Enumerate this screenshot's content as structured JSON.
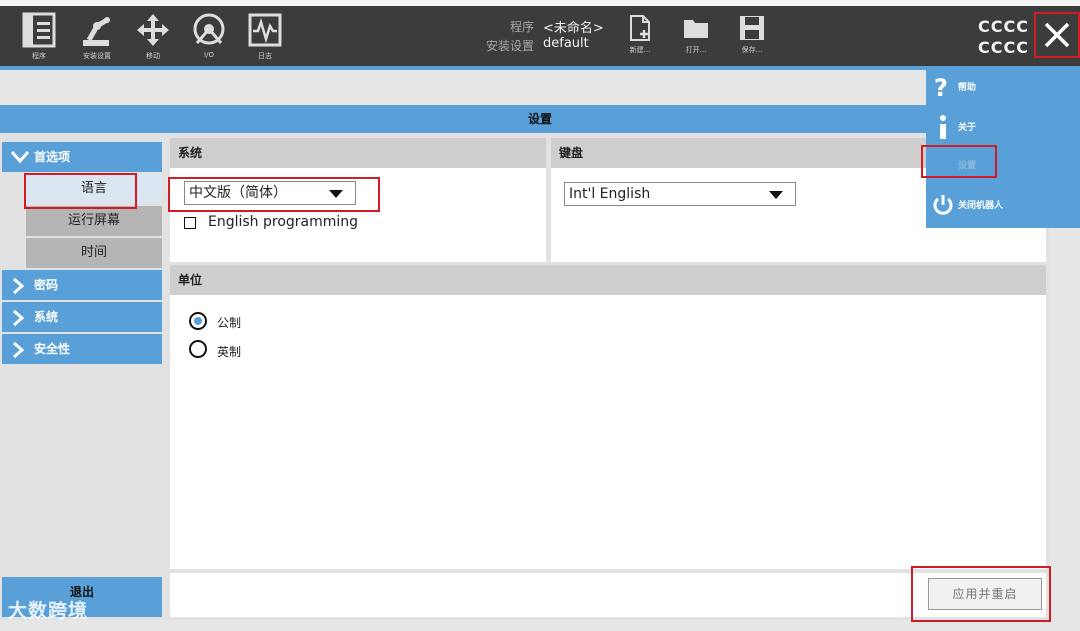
{
  "toolbar": {
    "nav": [
      {
        "label": "程序",
        "icon": "program-icon"
      },
      {
        "label": "安装设置",
        "icon": "robot-arm-icon"
      },
      {
        "label": "移动",
        "icon": "move-arrows-icon"
      },
      {
        "label": "I/O",
        "icon": "io-icon"
      },
      {
        "label": "日志",
        "icon": "log-icon"
      }
    ],
    "program_label": "程序",
    "program_value": "<未命名>",
    "install_label": "安装设置",
    "install_value": "default",
    "files": [
      {
        "label": "新建...",
        "icon": "new-file-icon"
      },
      {
        "label": "打开...",
        "icon": "folder-icon"
      },
      {
        "label": "保存...",
        "icon": "save-icon"
      }
    ],
    "status_line1": "CCCC",
    "status_line2": "CCCC"
  },
  "title": "设置",
  "sidebar": {
    "preferences": "首选项",
    "sub_items": [
      "语言",
      "运行屏幕",
      "时间"
    ],
    "password": "密码",
    "system": "系统",
    "safety": "安全性",
    "exit": "退出"
  },
  "system_panel": {
    "header": "系统",
    "language_selected": "中文版（简体）",
    "english_programming": "English programming",
    "english_programming_checked": false
  },
  "keyboard_panel": {
    "header": "键盘",
    "selected": "Int'l English"
  },
  "units_panel": {
    "header": "单位",
    "options": [
      "公制",
      "英制"
    ],
    "selected_index": 0
  },
  "apply_button": "应用并重启",
  "menu": {
    "items": [
      "帮助",
      "关于",
      "设置",
      "关闭机器人"
    ]
  },
  "watermark": "大数跨境",
  "colors": {
    "accent": "#5aa0d8",
    "topbar": "#3c3c3c",
    "highlight": "#d01c27"
  }
}
